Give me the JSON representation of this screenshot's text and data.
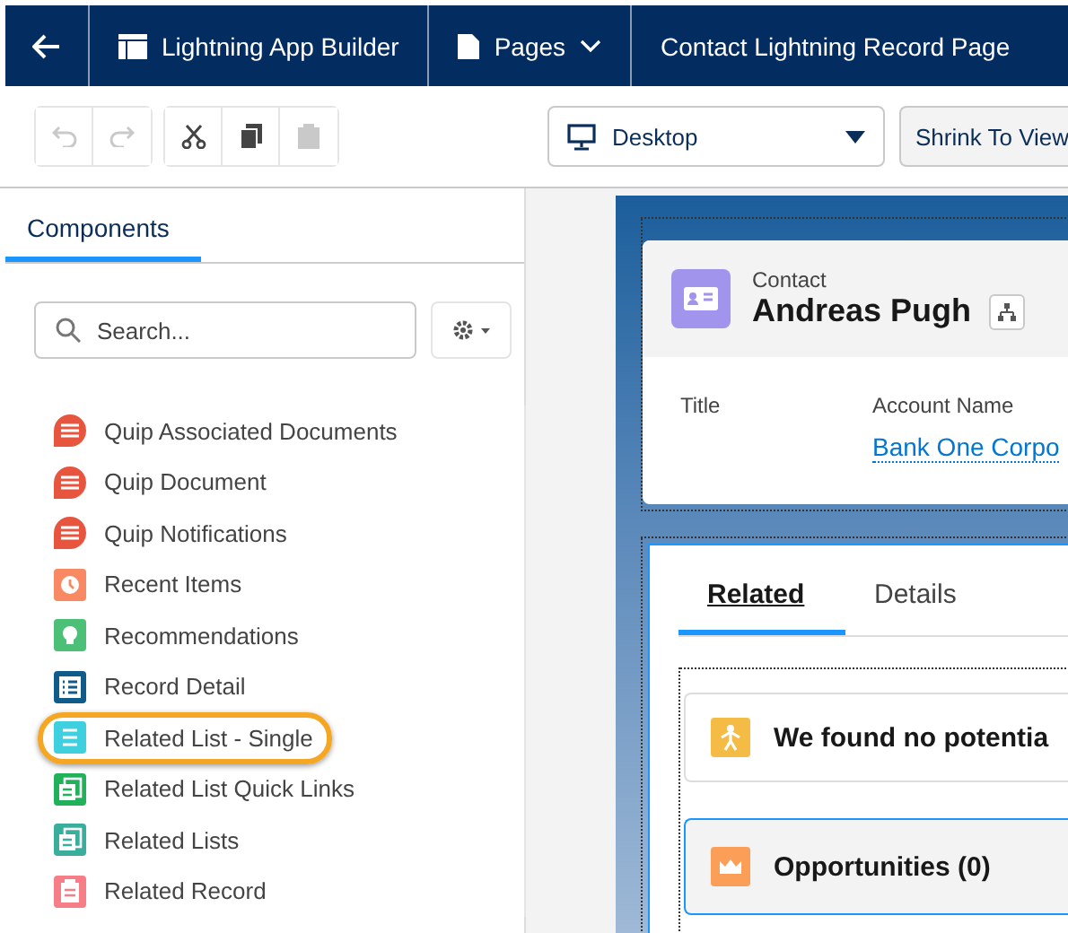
{
  "top_bar": {
    "app_name": "Lightning App Builder",
    "pages_menu": "Pages",
    "page_title": "Contact Lightning Record Page"
  },
  "toolbar": {
    "undo_disabled": true,
    "redo_disabled": true,
    "paste_disabled": true,
    "device": "Desktop",
    "zoom_button": "Shrink To View"
  },
  "panel_tabs": [
    {
      "label": "Components",
      "selected": true
    }
  ],
  "search": {
    "placeholder": "Search..."
  },
  "components": [
    {
      "label": "Quip Associated Documents",
      "kind": "quip",
      "color": "#e8553f",
      "highlighted": false
    },
    {
      "label": "Quip Document",
      "kind": "quip",
      "color": "#e8553f",
      "highlighted": false
    },
    {
      "label": "Quip Notifications",
      "kind": "quip",
      "color": "#e8553f",
      "highlighted": false
    },
    {
      "label": "Recent Items",
      "kind": "clock",
      "color": "#f88962",
      "highlighted": false
    },
    {
      "label": "Recommendations",
      "kind": "bulb",
      "color": "#4bc076",
      "highlighted": false
    },
    {
      "label": "Record Detail",
      "kind": "detail",
      "color": "#0f5b8a",
      "highlighted": false
    },
    {
      "label": "Related List - Single",
      "kind": "lines",
      "color": "#3fd0e0",
      "highlighted": true
    },
    {
      "label": "Related List Quick Links",
      "kind": "stack",
      "color": "#20b15a",
      "highlighted": false
    },
    {
      "label": "Related Lists",
      "kind": "stack",
      "color": "#3aae9c",
      "highlighted": false
    },
    {
      "label": "Related Record",
      "kind": "clipboard",
      "color": "#f77e86",
      "highlighted": false
    }
  ],
  "record": {
    "object": "Contact",
    "name": "Andreas Pugh",
    "fields": [
      {
        "label": "Title"
      },
      {
        "label": "Account Name",
        "value": "Bank One Corpo"
      }
    ]
  },
  "record_tabs": [
    {
      "label": "Related",
      "selected": true
    },
    {
      "label": "Details",
      "selected": false
    }
  ],
  "cards": [
    {
      "title": "We found no potentia",
      "kind": "person",
      "color": "#f4bc45"
    },
    {
      "title": "Opportunities (0)",
      "kind": "crown",
      "color": "#fb9f58"
    }
  ]
}
